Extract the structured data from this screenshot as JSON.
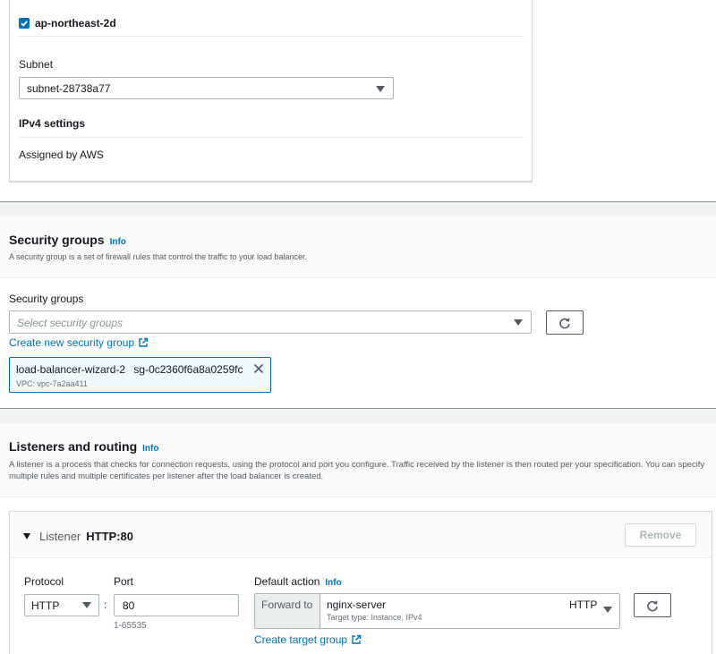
{
  "az": {
    "checkbox_label": "ap-northeast-2d",
    "subnet_label": "Subnet",
    "subnet_value": "subnet-28738a77",
    "ipv4_heading": "IPv4 settings",
    "ipv4_value": "Assigned by AWS"
  },
  "security": {
    "heading": "Security groups",
    "info": "Info",
    "description": "A security group is a set of firewall rules that control the traffic to your load balancer.",
    "field_label": "Security groups",
    "placeholder": "Select security groups",
    "create_link": "Create new security group",
    "token_name": "load-balancer-wizard-2",
    "token_id": "sg-0c2360f6a8a0259fc",
    "token_vpc": "VPC: vpc-7a2aa411"
  },
  "listeners": {
    "heading": "Listeners and routing",
    "info": "Info",
    "description": "A listener is a process that checks for connection requests, using the protocol and port you configure. Traffic received by the listener is then routed per your specification. You can specify multiple rules and multiple certificates per listener after the load balancer is created.",
    "listener_label": "Listener",
    "listener_value": "HTTP:80",
    "remove_button": "Remove",
    "protocol_label": "Protocol",
    "protocol_value": "HTTP",
    "port_label": "Port",
    "port_separator": ":",
    "port_value": "80",
    "port_hint": "1-65535",
    "default_action_label": "Default action",
    "default_action_info": "Info",
    "forward_to": "Forward to",
    "target_name": "nginx-server",
    "target_meta": "Target type: Instance, IPv4",
    "target_protocol": "HTTP",
    "create_target_link": "Create target group"
  }
}
